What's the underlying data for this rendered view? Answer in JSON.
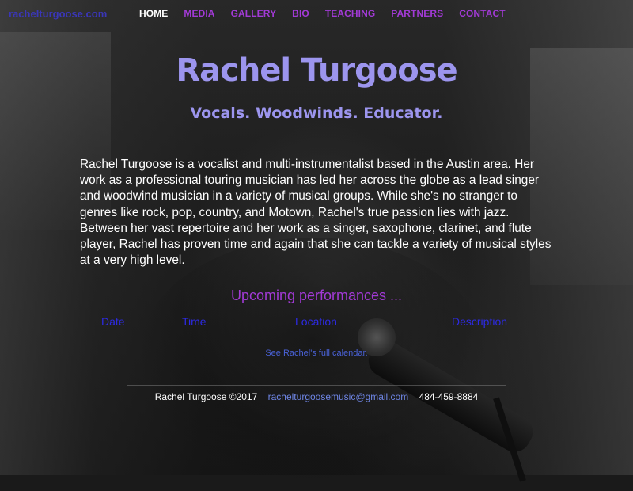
{
  "nav": {
    "site_link": "rachelturgoose.com",
    "items": [
      {
        "label": "HOME",
        "active": true
      },
      {
        "label": "MEDIA",
        "active": false
      },
      {
        "label": "GALLERY",
        "active": false
      },
      {
        "label": "BIO",
        "active": false
      },
      {
        "label": "TEACHING",
        "active": false
      },
      {
        "label": "PARTNERS",
        "active": false
      },
      {
        "label": "CONTACT",
        "active": false
      }
    ]
  },
  "hero": {
    "title": "Rachel Turgoose",
    "tagline": "Vocals. Woodwinds. Educator."
  },
  "bio": {
    "text": "Rachel Turgoose is a vocalist and multi-instrumentalist based in the Austin area. Her work as a professional touring musician has led her across the globe as a lead singer and woodwind musician in a variety of musical groups. While she's no stranger to genres like rock, pop, country, and Motown, Rachel's true passion lies with jazz. Between her vast repertoire and her work as a singer, saxophone, clarinet, and flute player, Rachel has proven time and again that she can tackle a variety of musical styles at a very high level."
  },
  "performances": {
    "heading": "Upcoming performances ...",
    "columns": [
      "Date",
      "Time",
      "Location",
      "Description"
    ],
    "calendar_link": "See Rachel's full calendar."
  },
  "footer": {
    "copyright": "Rachel Turgoose ©2017",
    "email": "rachelturgoosemusic@gmail.com",
    "phone": "484-459-8884"
  },
  "colors": {
    "nav_link": "#a23ad6",
    "nav_active": "#ffffff",
    "title": "#9c95ee",
    "table_header": "#2d2ae3",
    "email": "#6f86e6"
  }
}
